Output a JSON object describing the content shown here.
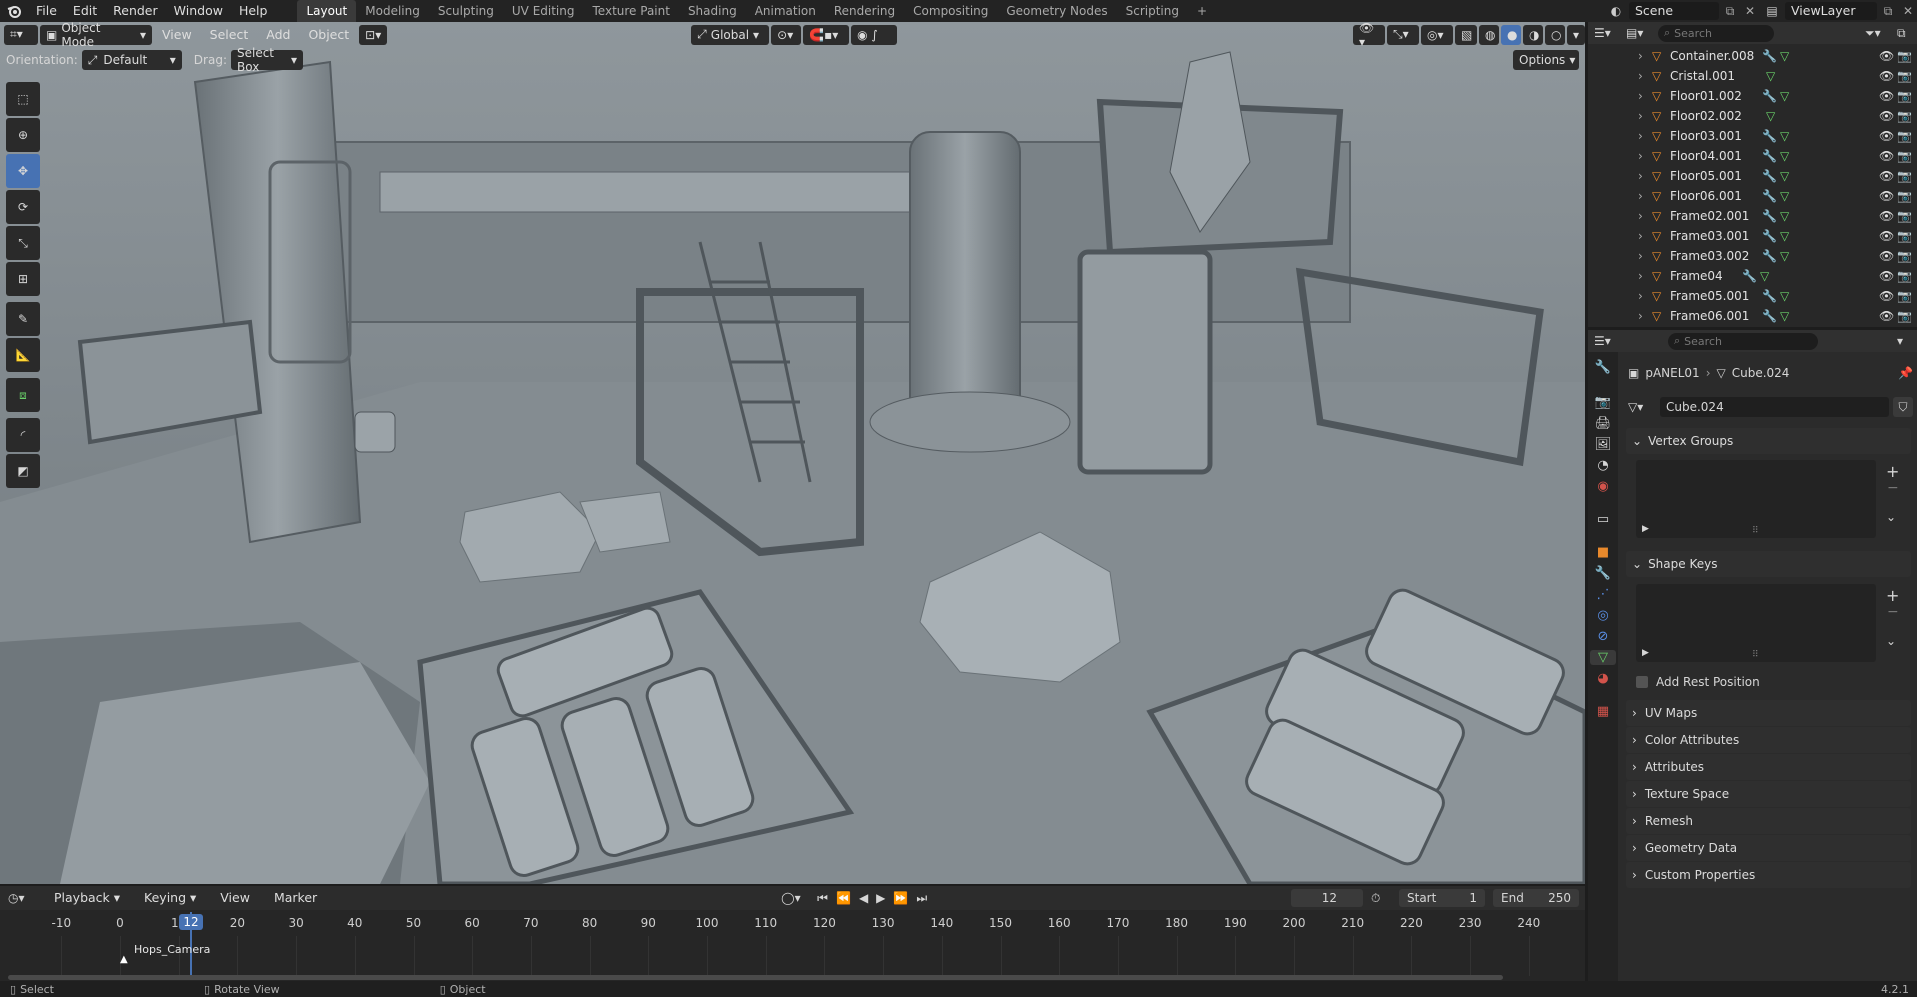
{
  "topbar": {
    "menus": [
      "File",
      "Edit",
      "Render",
      "Window",
      "Help"
    ],
    "workspaces": [
      "Layout",
      "Modeling",
      "Sculpting",
      "UV Editing",
      "Texture Paint",
      "Shading",
      "Animation",
      "Rendering",
      "Compositing",
      "Geometry Nodes",
      "Scripting"
    ],
    "active_workspace": "Layout",
    "scene": "Scene",
    "view_layer": "ViewLayer"
  },
  "viewport_header": {
    "mode": "Object Mode",
    "menus": [
      "View",
      "Select",
      "Add",
      "Object"
    ],
    "transform_orientation": "Global",
    "orientation_label": "Orientation:",
    "orientation_value": "Default",
    "drag_label": "Drag:",
    "drag_value": "Select Box",
    "options_label": "Options"
  },
  "toolbar": {
    "tools": [
      "select-box-icon",
      "cursor-icon",
      "move-icon",
      "rotate-icon",
      "scale-icon",
      "transform-icon",
      "annotate-icon",
      "measure-icon",
      "add-cube-icon",
      "shear-icon",
      "extrude-icon"
    ],
    "active_tool": "move-icon"
  },
  "outliner": {
    "search_placeholder": "Search",
    "items": [
      {
        "name": "Container.008"
      },
      {
        "name": "Cristal.001"
      },
      {
        "name": "Floor01.002"
      },
      {
        "name": "Floor02.002"
      },
      {
        "name": "Floor03.001"
      },
      {
        "name": "Floor04.001"
      },
      {
        "name": "Floor05.001"
      },
      {
        "name": "Floor06.001"
      },
      {
        "name": "Frame02.001"
      },
      {
        "name": "Frame03.001"
      },
      {
        "name": "Frame03.002"
      },
      {
        "name": "Frame04"
      },
      {
        "name": "Frame05.001"
      },
      {
        "name": "Frame06.001"
      }
    ]
  },
  "properties": {
    "search_placeholder": "Search",
    "breadcrumb_object": "pANEL01",
    "breadcrumb_data": "Cube.024",
    "mesh_name": "Cube.024",
    "vertex_groups": "Vertex Groups",
    "shape_keys": "Shape Keys",
    "add_rest_position": "Add Rest Position",
    "collapsed_panels": [
      "UV Maps",
      "Color Attributes",
      "Attributes",
      "Texture Space",
      "Remesh",
      "Geometry Data",
      "Custom Properties"
    ]
  },
  "timeline": {
    "menus": [
      "Playback",
      "Keying",
      "View",
      "Marker"
    ],
    "current_frame": "12",
    "start_label": "Start",
    "start": "1",
    "end_label": "End",
    "end": "250",
    "ticks": [
      "-10",
      "0",
      "10",
      "20",
      "30",
      "40",
      "50",
      "60",
      "70",
      "80",
      "90",
      "100",
      "110",
      "120",
      "130",
      "140",
      "150",
      "160",
      "170",
      "180",
      "190",
      "200",
      "210",
      "220",
      "230",
      "240"
    ],
    "marker_name": "Hops_Camera",
    "playhead_label": "12"
  },
  "statusbar": {
    "items": [
      "Select",
      "Rotate View",
      "Object"
    ],
    "version": "4.2.1"
  },
  "colors": {
    "accent": "#4772b3",
    "viewport_bg": "#7d858a",
    "mesh_icon": "#6ad16a",
    "object_icon": "#e8892c"
  }
}
